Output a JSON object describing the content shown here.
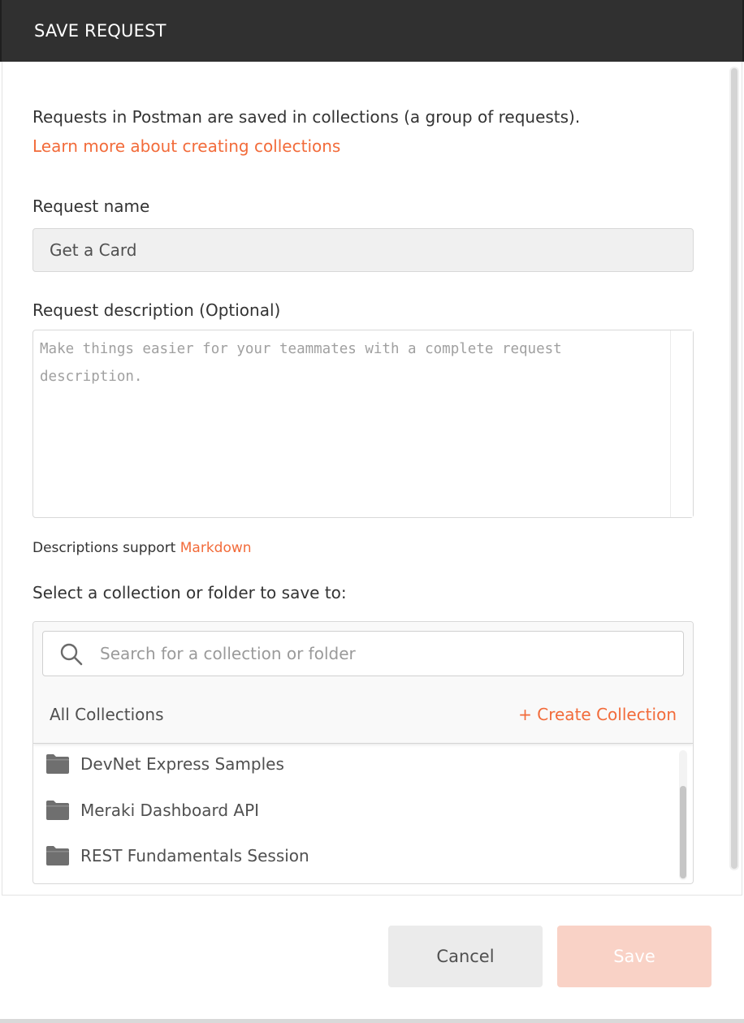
{
  "dialog": {
    "title": "SAVE REQUEST",
    "intro": "Requests in Postman are saved in collections (a group of requests).",
    "learn_link": "Learn more about creating collections",
    "accent_color": "#f26b3a"
  },
  "request_name": {
    "label": "Request name",
    "value": "Get a Card"
  },
  "request_description": {
    "label": "Request description (Optional)",
    "placeholder": "Make things easier for your teammates with a complete request description.",
    "note_prefix": "Descriptions support",
    "note_link": "Markdown"
  },
  "collections": {
    "label": "Select a collection or folder to save to:",
    "search_placeholder": "Search for a collection or folder",
    "all_label": "All Collections",
    "create_label": "+ Create Collection",
    "items": [
      {
        "name": "DevNet Express Samples",
        "icon": "folder-icon"
      },
      {
        "name": "Meraki Dashboard API",
        "icon": "folder-icon"
      },
      {
        "name": "REST Fundamentals Session",
        "icon": "folder-icon"
      }
    ]
  },
  "footer": {
    "cancel_label": "Cancel",
    "save_label": "Save"
  }
}
